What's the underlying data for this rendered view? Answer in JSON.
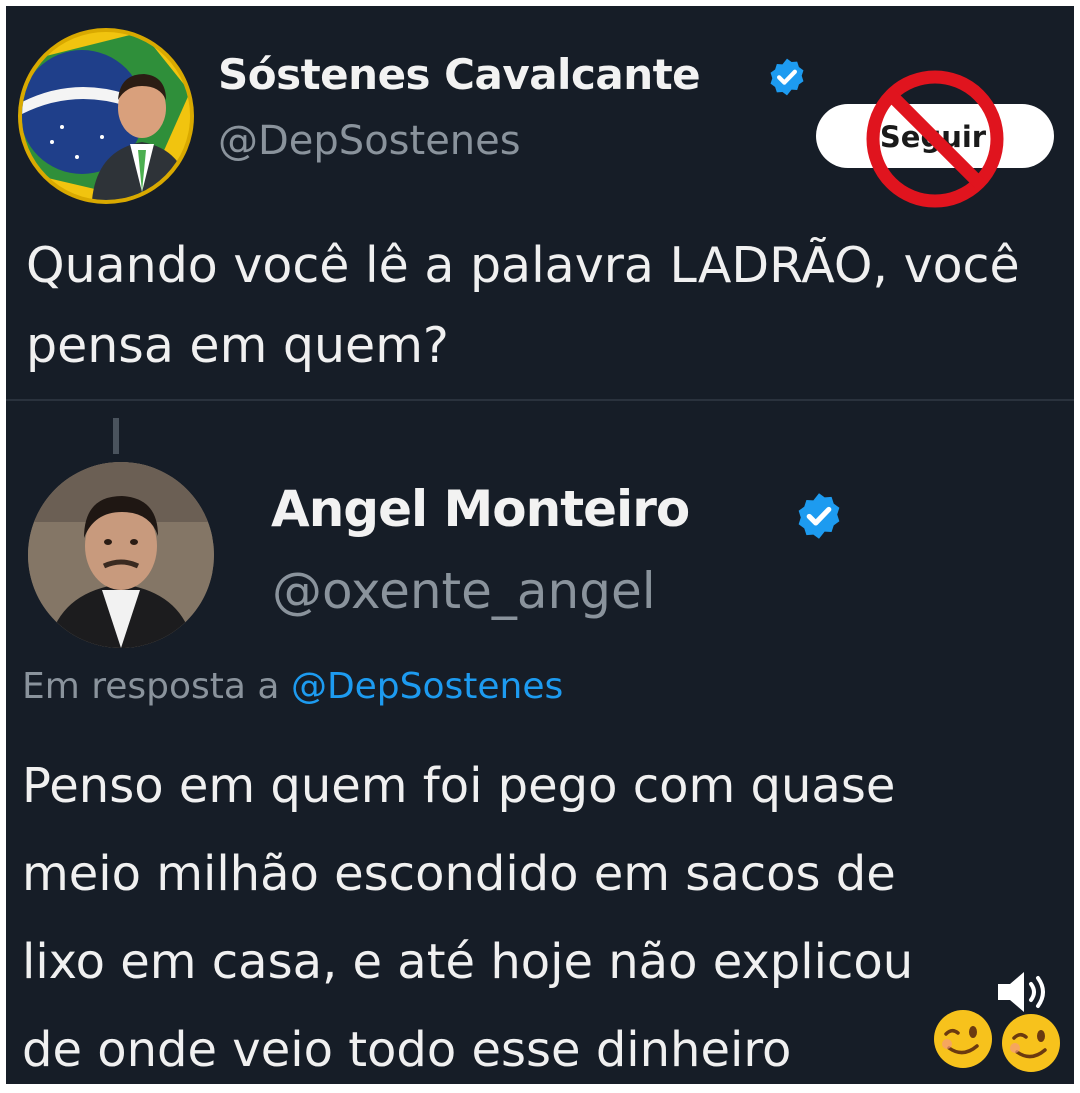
{
  "tweet": {
    "author_name": "Sóstenes Cavalcante",
    "author_handle": "@DepSostenes",
    "follow_label": "Seguir",
    "text": "Quando você lê a palavra LADRÃO, você pensa em quem?"
  },
  "reply": {
    "author_name": "Angel Monteiro",
    "author_handle": "@oxente_angel",
    "reply_to_prefix": "Em resposta a",
    "reply_to_handle": "@DepSostenes",
    "lines": [
      "Penso em quem foi pego com quase",
      "meio milhão escondido em sacos de",
      "lixo em casa, e até hoje não explicou",
      "de onde veio todo esse dinheiro"
    ]
  },
  "icons": {
    "verified": "verified-badge-icon",
    "prohibited": "no-entry-sign-icon",
    "emoji": "winking-face-emoji",
    "sound": "speaker-icon"
  },
  "colors": {
    "background": "#161d27",
    "verified_blue": "#1d9bf0",
    "mention_blue": "#1d9bf0",
    "prohibition_red": "#e0141e"
  }
}
